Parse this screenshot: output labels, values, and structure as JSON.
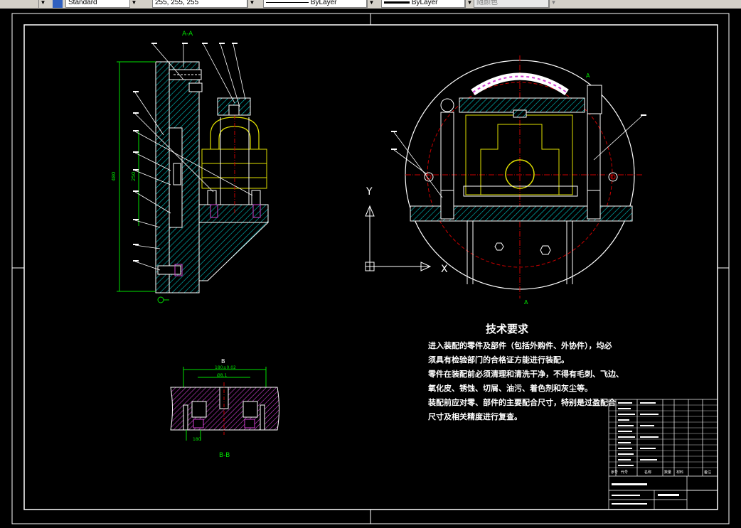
{
  "toolbar": {
    "text_style": "Standard",
    "color_value": "255, 255, 255",
    "linetype": "ByLayer",
    "lineweight": "ByLayer",
    "plot_style": "随颜色"
  },
  "drawing": {
    "section_label_top": "A-A",
    "section_label_bottom": "B-B",
    "view_marker_a": "A",
    "axis_y_label": "Y",
    "axis_x_label": "X",
    "dim_vertical": "480",
    "dim_vertical_2": "250",
    "dim_horizontal_b": "180±0.02",
    "dim_b_inner": "Ø8.1",
    "dim_b_bottom": "180",
    "top_marker_b": "B"
  },
  "tech": {
    "title": "技术要求",
    "lines": [
      "进入装配的零件及部件（包括外购件、外协件），均必",
      "须具有检验部门的合格证方能进行装配。",
      "零件在装配前必须清理和清洗干净，不得有毛刺、飞边、",
      "氧化皮、锈蚀、切屑、油污、着色剂和灰尘等。",
      "装配前应对零、部件的主要配合尺寸，特别是过盈配合",
      "尺寸及相关精度进行复查。"
    ]
  },
  "title_block": {
    "headers": [
      "序号",
      "代号",
      "名称",
      "数量",
      "材料",
      "备注"
    ]
  }
}
